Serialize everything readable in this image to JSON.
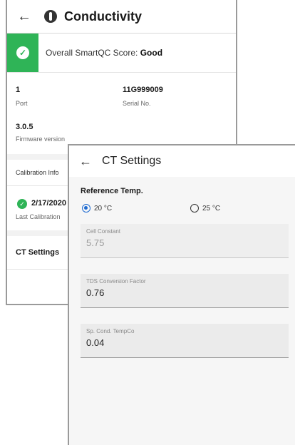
{
  "back_screen": {
    "title": "Conductivity",
    "qc_label": "Overall SmartQC Score: ",
    "qc_value": "Good",
    "port_value": "1",
    "port_label": "Port",
    "serial_value": "11G999009",
    "serial_label": "Serial No.",
    "firmware_value": "3.0.5",
    "firmware_label": "Firmware version",
    "calibration_header": "Calibration Info",
    "calibration_date": "2/17/2020",
    "calibration_label": "Last Calibration",
    "ct_settings": "CT Settings"
  },
  "front_screen": {
    "title": "CT Settings",
    "reference_temp_label": "Reference Temp.",
    "radio_20": "20 °C",
    "radio_25": "25 °C",
    "selected_temp": "20 °C",
    "fields": [
      {
        "label": "Cell Constant",
        "value": "5.75",
        "disabled": true
      },
      {
        "label": "TDS Conversion Factor",
        "value": "0.76",
        "disabled": false
      },
      {
        "label": "Sp. Cond. TempCo",
        "value": "0.04",
        "disabled": false
      }
    ]
  },
  "colors": {
    "accent_green": "#2fb457",
    "radio_blue": "#1e6bd1"
  }
}
